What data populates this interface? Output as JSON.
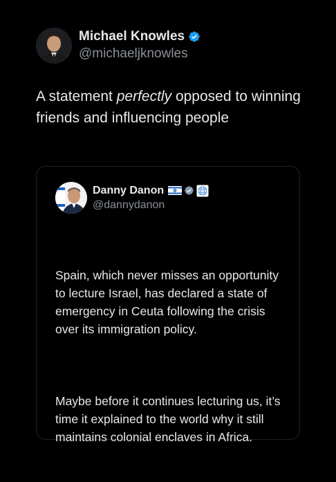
{
  "post": {
    "author": {
      "name": "Michael Knowles",
      "handle": "@michaeljknowles",
      "verified_icon": "verified-badge-icon",
      "avatar_icon": "avatar"
    },
    "text_before": "A statement ",
    "text_emphasis": "perfectly",
    "text_after": " opposed to winning friends and influencing people"
  },
  "quote": {
    "author": {
      "name": "Danny Danon",
      "handle": "@dannydanon",
      "flag_icon": "israel-flag-icon",
      "verified_icon": "government-verified-badge-icon",
      "affiliate_icon": "un-affiliate-badge-icon"
    },
    "paragraph_1": "Spain, which never misses an opportunity to lecture Israel, has declared a state of emergency in Ceuta following the crisis over its immigration policy.",
    "paragraph_2": "Maybe before it continues lecturing us, it’s time it explained to the world why it still maintains colonial enclaves in Africa."
  },
  "colors": {
    "background": "#000000",
    "text_primary": "#e7e9ea",
    "text_secondary": "#8b9096",
    "verified_blue": "#1d9bf0",
    "card_border": "#1f2124"
  }
}
